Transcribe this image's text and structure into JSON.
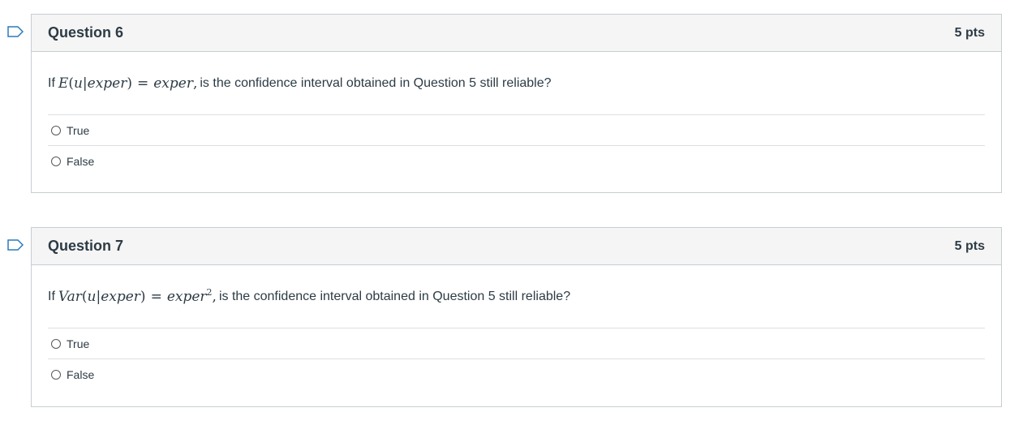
{
  "questions": [
    {
      "title": "Question 6",
      "points": "5 pts",
      "text_prefix": "If",
      "math": {
        "lhs_fn": "E",
        "lhs_arg_var": "u",
        "lhs_arg_given": "exper",
        "op": "=",
        "rhs": "exper",
        "rhs_sup": "",
        "trail": ","
      },
      "text_suffix": "is the confidence interval obtained in Question 5 still reliable?",
      "answers": [
        "True",
        "False"
      ],
      "flag_color": "#2b7abc"
    },
    {
      "title": "Question 7",
      "points": "5 pts",
      "text_prefix": "If",
      "math": {
        "lhs_fn": "Var",
        "lhs_arg_var": "u",
        "lhs_arg_given": "exper",
        "op": "=",
        "rhs": "exper",
        "rhs_sup": "2",
        "trail": ","
      },
      "text_suffix": "is the confidence interval obtained in Question 5 still reliable?",
      "answers": [
        "True",
        "False"
      ],
      "flag_color": "#2b7abc"
    }
  ]
}
